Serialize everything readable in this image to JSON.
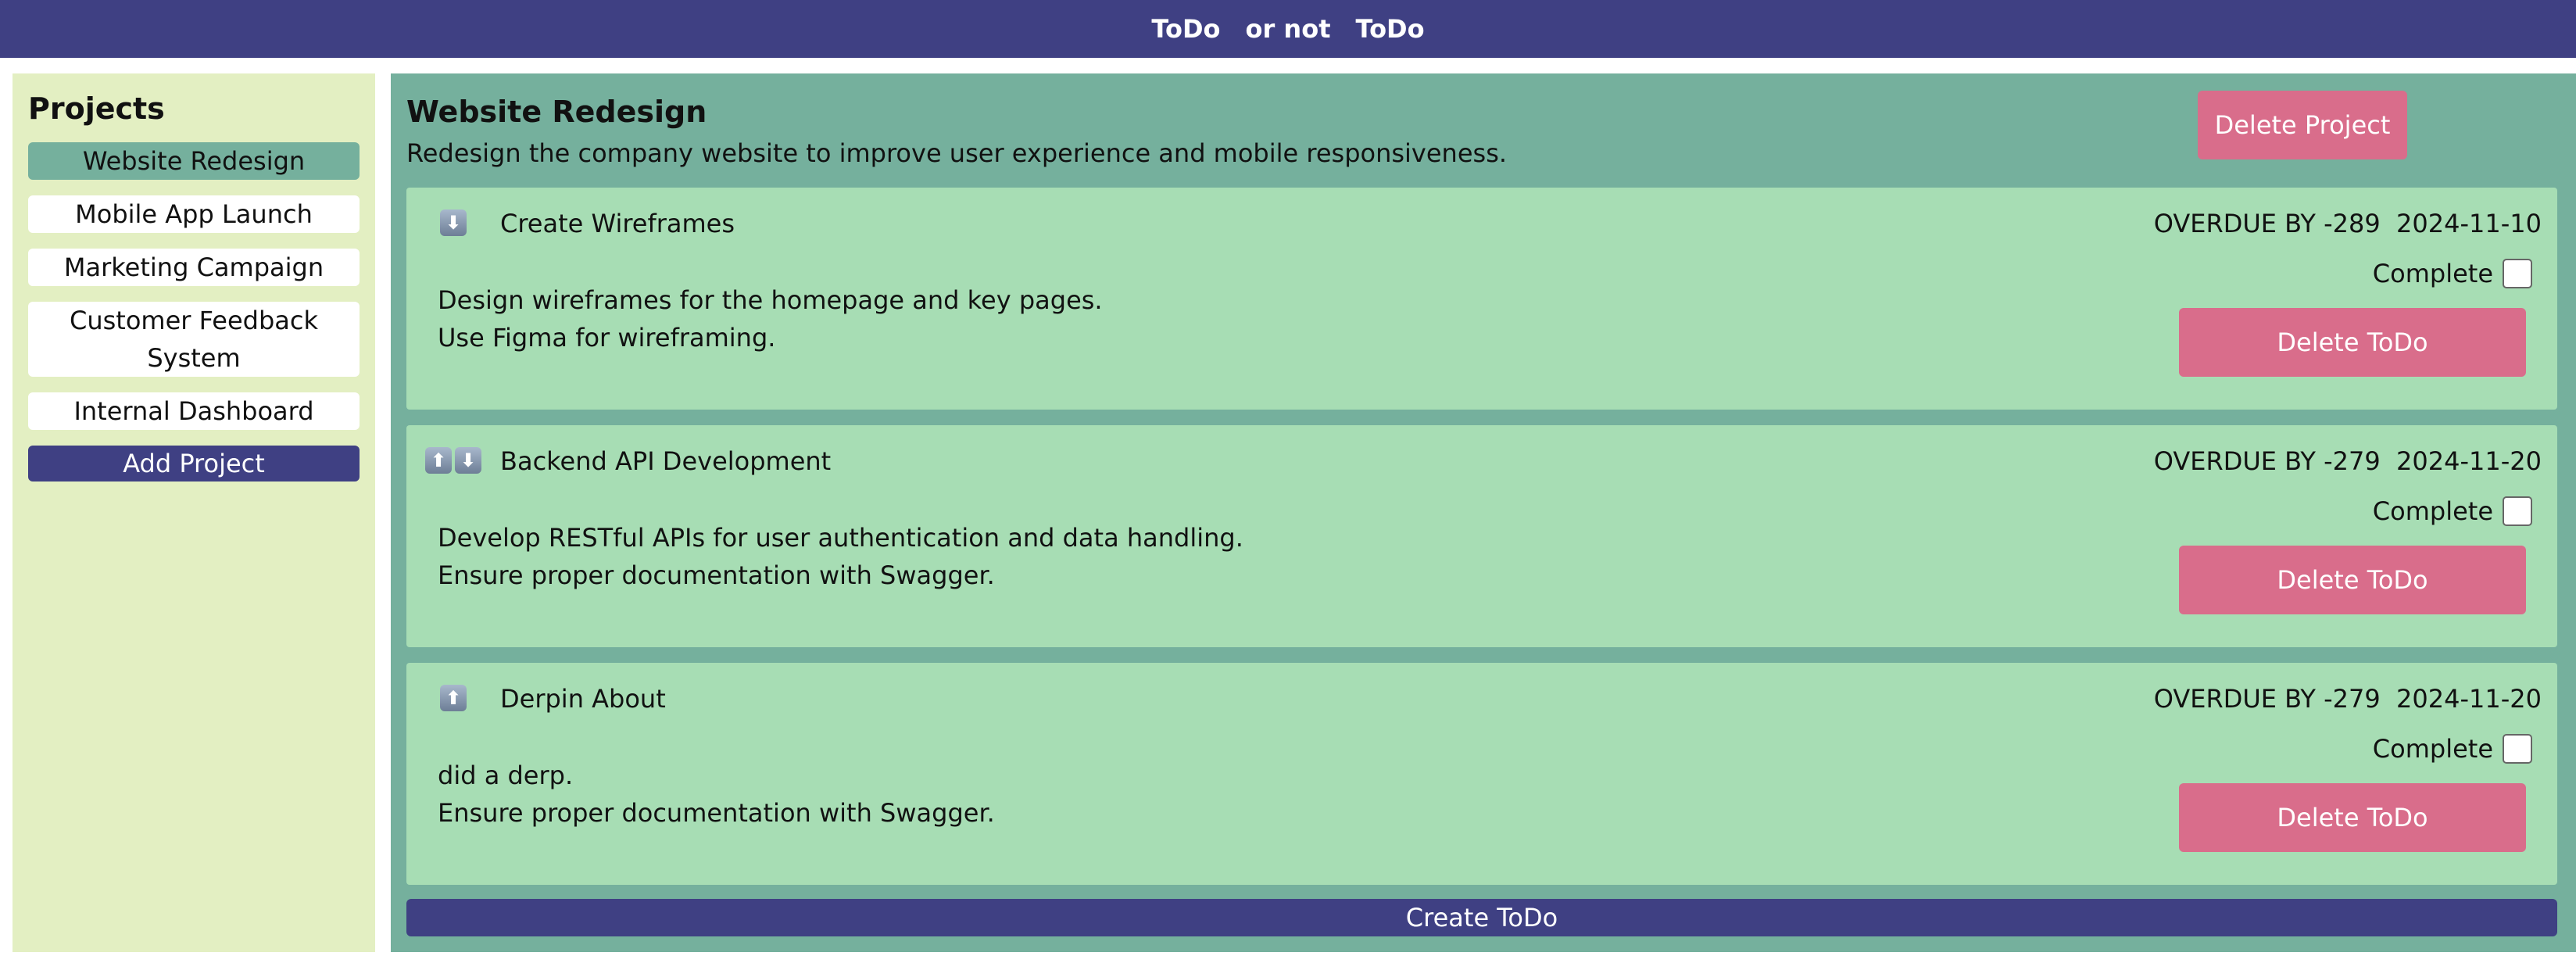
{
  "header": {
    "title_parts": [
      "ToDo",
      "or not",
      "ToDo"
    ]
  },
  "sidebar": {
    "heading": "Projects",
    "projects": [
      {
        "label": "Website Redesign",
        "active": true
      },
      {
        "label": "Mobile App Launch",
        "active": false
      },
      {
        "label": "Marketing Campaign",
        "active": false
      },
      {
        "label": "Customer Feedback System",
        "active": false
      },
      {
        "label": "Internal Dashboard",
        "active": false
      }
    ],
    "add_project_label": "Add Project"
  },
  "project": {
    "title": "Website Redesign",
    "description": "Redesign the company website to improve user experience and mobile responsiveness.",
    "delete_label": "Delete Project"
  },
  "todos": [
    {
      "title": "Create Wireframes",
      "due_text": "OVERDUE BY -289  2024-11-10",
      "complete_label": "Complete",
      "completed": false,
      "desc_lines": [
        "Design wireframes for the homepage and key pages.",
        "Use Figma for wireframing."
      ],
      "delete_label": "Delete ToDo",
      "arrows": [
        "down-arrow-icon"
      ]
    },
    {
      "title": "Backend API Development",
      "due_text": "OVERDUE BY -279  2024-11-20",
      "complete_label": "Complete",
      "completed": false,
      "desc_lines": [
        "Develop RESTful APIs for user authentication and data handling.",
        "Ensure proper documentation with Swagger."
      ],
      "delete_label": "Delete ToDo",
      "arrows": [
        "up-arrow-icon",
        "down-arrow-icon"
      ]
    },
    {
      "title": "Derpin About",
      "due_text": "OVERDUE BY -279  2024-11-20",
      "complete_label": "Complete",
      "completed": false,
      "desc_lines": [
        "did a derp.",
        "Ensure proper documentation with Swagger."
      ],
      "delete_label": "Delete ToDo",
      "arrows": [
        "up-arrow-icon"
      ]
    }
  ],
  "create_todo_label": "Create ToDo",
  "colors": {
    "header_bg": "#3f4083",
    "sidebar_bg": "#e3efc2",
    "main_bg": "#75b09d",
    "todo_bg": "#a7ddb4",
    "danger": "#d96d8b",
    "active_project": "#75b09d"
  }
}
